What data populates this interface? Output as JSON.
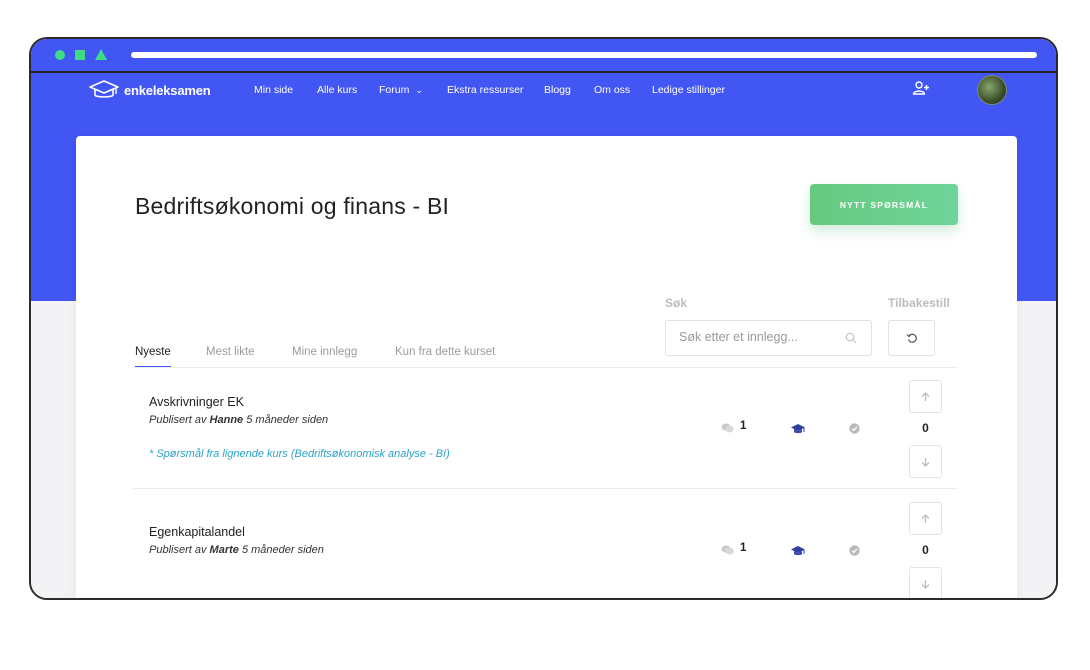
{
  "nav": {
    "brand": "enkeleksamen",
    "items": [
      "Min side",
      "Alle kurs",
      "Forum",
      "Ekstra ressurser",
      "Blogg",
      "Om oss",
      "Ledige stillinger"
    ]
  },
  "page": {
    "title": "Bedriftsøkonomi og finans - BI",
    "new_question": "NYTT SPØRSMÅL"
  },
  "search": {
    "label": "Søk",
    "placeholder": "Søk etter et innlegg...",
    "reset_label": "Tilbakestill"
  },
  "tabs": [
    "Nyeste",
    "Mest likte",
    "Mine innlegg",
    "Kun fra dette kurset"
  ],
  "posts": [
    {
      "title": "Avskrivninger EK",
      "meta_prefix": "Publisert av",
      "author": "Hanne",
      "time": "5 måneder siden",
      "similar": "* Spørsmål fra lignende kurs (Bedriftsøkonomisk analyse - BI)",
      "comments": "1",
      "votes": "0"
    },
    {
      "title": "Egenkapitalandel",
      "meta_prefix": "Publisert av",
      "author": "Marte",
      "time": "5 måneder siden",
      "comments": "1",
      "votes": "0"
    }
  ],
  "colors": {
    "brand_blue": "#4256f4",
    "button_green": "#6fd49a",
    "link_teal": "#2aa2c7"
  }
}
